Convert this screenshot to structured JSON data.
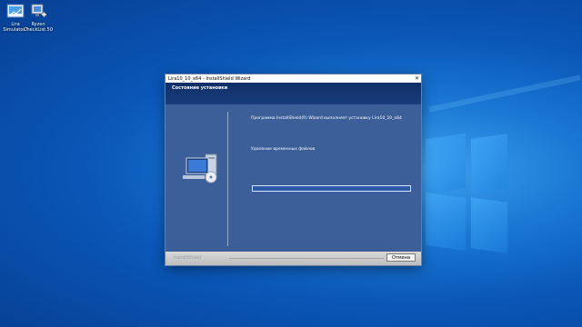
{
  "desktop": {
    "icons": [
      {
        "label": "Lira\nSimulator7",
        "icon": "shortcut-icon"
      },
      {
        "label": "Ryzen\nCheckList.50",
        "icon": "network-app-icon"
      }
    ]
  },
  "window": {
    "title": "Lira10_10_x64 - InstallShield Wizard",
    "header": "Состояние установки",
    "message": "Программа InstallShield(R) Wizard выполняет установку Lira10_10_x64",
    "status": "Удаление временных файлов",
    "progress": 0,
    "brand": "InstallShield",
    "cancel_label": "Отмена"
  },
  "colors": {
    "dialog_bg": "#3c5f9a",
    "header_bg": "#1a3d7c",
    "desktop_accent": "#1a78d4"
  }
}
